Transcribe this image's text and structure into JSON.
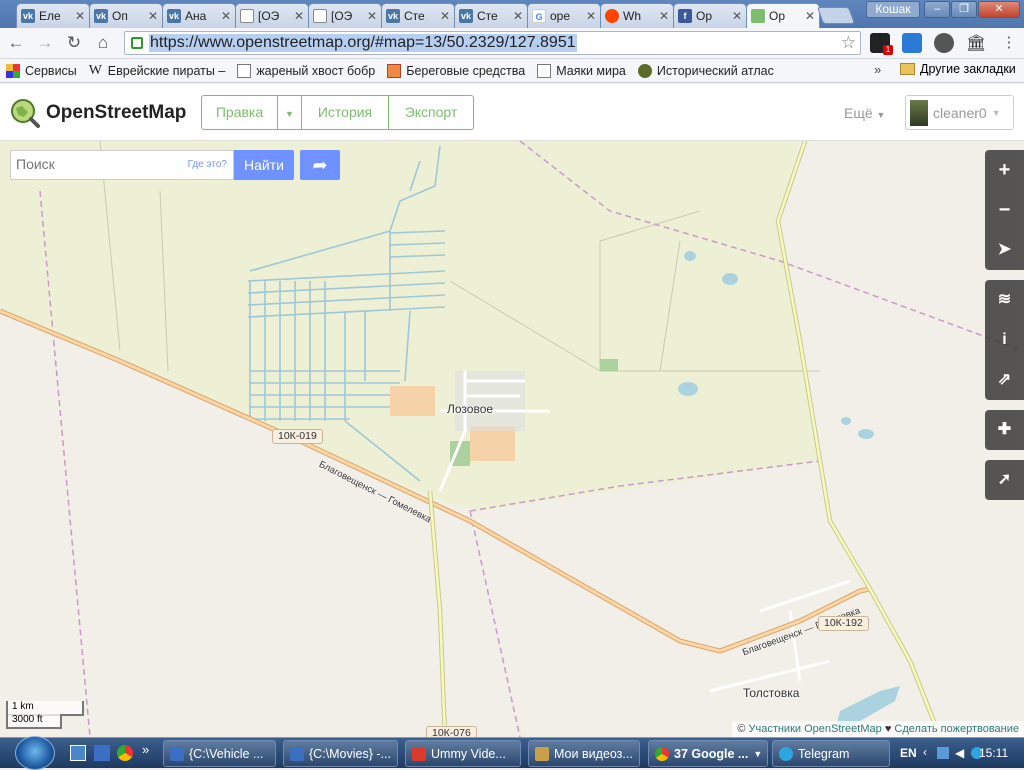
{
  "browser": {
    "tabs": [
      {
        "label": "Еле",
        "icon": "vk-icon",
        "color": "#4a76a8"
      },
      {
        "label": "Оп",
        "icon": "vk-icon",
        "color": "#4a76a8"
      },
      {
        "label": "Ана",
        "icon": "vk-icon",
        "color": "#4a76a8"
      },
      {
        "label": "[ОЭ",
        "icon": "document-icon",
        "color": "#888888"
      },
      {
        "label": "[ОЭ",
        "icon": "document-icon",
        "color": "#888888"
      },
      {
        "label": "Сте",
        "icon": "vk-icon",
        "color": "#4a76a8"
      },
      {
        "label": "Сте",
        "icon": "vk-icon",
        "color": "#4a76a8"
      },
      {
        "label": "оре",
        "icon": "google-icon",
        "color": "#4285f4"
      },
      {
        "label": "Wh",
        "icon": "reddit-icon",
        "color": "#ff4500"
      },
      {
        "label": "Ор",
        "icon": "facebook-icon",
        "color": "#3b5998"
      },
      {
        "label": "Ор",
        "icon": "osm-icon",
        "color": "#7ebc6f",
        "active": true
      }
    ],
    "profile_name": "Кошак",
    "url": "https://www.openstreetmap.org/#map=13/50.2329/127.8951",
    "bookmarks": [
      {
        "label": "Сервисы",
        "icon": "apps-icon"
      },
      {
        "label": "Еврейские пираты –",
        "icon": "wikipedia-icon"
      },
      {
        "label": "жареный хвост бобр",
        "icon": "page-icon"
      },
      {
        "label": "Береговые средства",
        "icon": "site-icon"
      },
      {
        "label": "Маяки мира",
        "icon": "page-icon"
      },
      {
        "label": "Исторический атлас",
        "icon": "atlas-icon"
      }
    ],
    "bookmarks_more": "»",
    "other_bookmarks": "Другие закладки"
  },
  "osm": {
    "logo_text": "OpenStreetMap",
    "edit_label": "Правка",
    "history_label": "История",
    "export_label": "Экспорт",
    "more_label": "Ещё",
    "user_name": "cleaner0",
    "search_placeholder": "Поиск",
    "where_label": "Где это?",
    "find_label": "Найти",
    "scale_km": "1 km",
    "scale_ft": "3000 ft",
    "attribution_prefix": "©",
    "attribution_link": "Участники OpenStreetMap",
    "attribution_heart": "♥",
    "attribution_donate": "Сделать пожертвование"
  },
  "map_labels": {
    "village1": "Лозовое",
    "village2": "Толстовка",
    "road_name1": "Благовещенск — Гомелевка",
    "road_name2": "Благовещенск — Гомелевка",
    "shield1": "10К-019",
    "shield2": "10К-192",
    "shield3": "10К-076"
  },
  "taskbar": {
    "tasks": [
      {
        "label": "{C:\\Vehicle ...",
        "color": "#3a6fc2"
      },
      {
        "label": "{C:\\Movies} -...",
        "color": "#3a6fc2"
      },
      {
        "label": "Ummy Vide...",
        "color": "#d93a2b"
      },
      {
        "label": "Мои видеоз...",
        "color": "#c9a04a"
      },
      {
        "label": "37 Google ...",
        "color": "#4285f4"
      },
      {
        "label": "Telegram",
        "color": "#2ca5e0"
      }
    ],
    "lang": "EN",
    "time": "15:11"
  },
  "colors": {
    "osm_green": "#7ebc6f",
    "osm_blue": "#7092ff",
    "farmland": "#eef0d5",
    "road": "#f4c78a",
    "water": "#aad3df"
  }
}
